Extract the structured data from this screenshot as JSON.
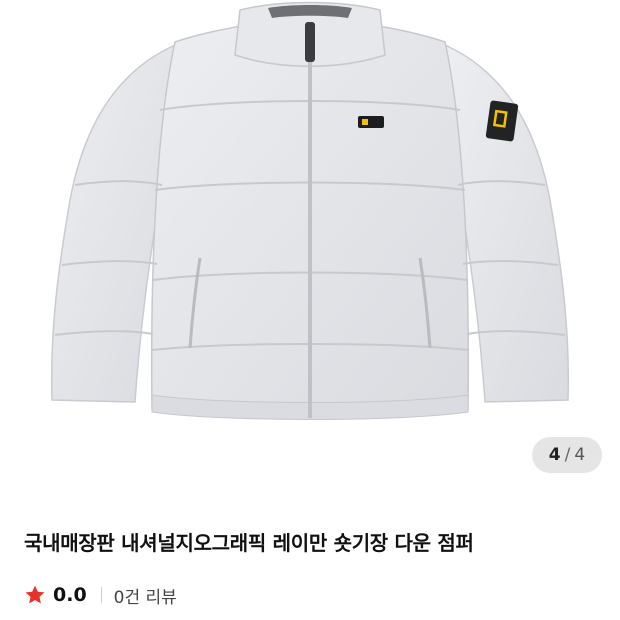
{
  "gallery": {
    "image_alt": "Light grey padded puffer jacket product photo",
    "current": "4",
    "separator": "/",
    "total": "4"
  },
  "product": {
    "title": "국내매장판 내셔널지오그래픽 레이만 숏기장 다운 점퍼",
    "rating": "0.0",
    "review_count_label": "0건 리뷰"
  },
  "colors": {
    "star": "#e8312b",
    "jacket": "#e4e6ea"
  }
}
